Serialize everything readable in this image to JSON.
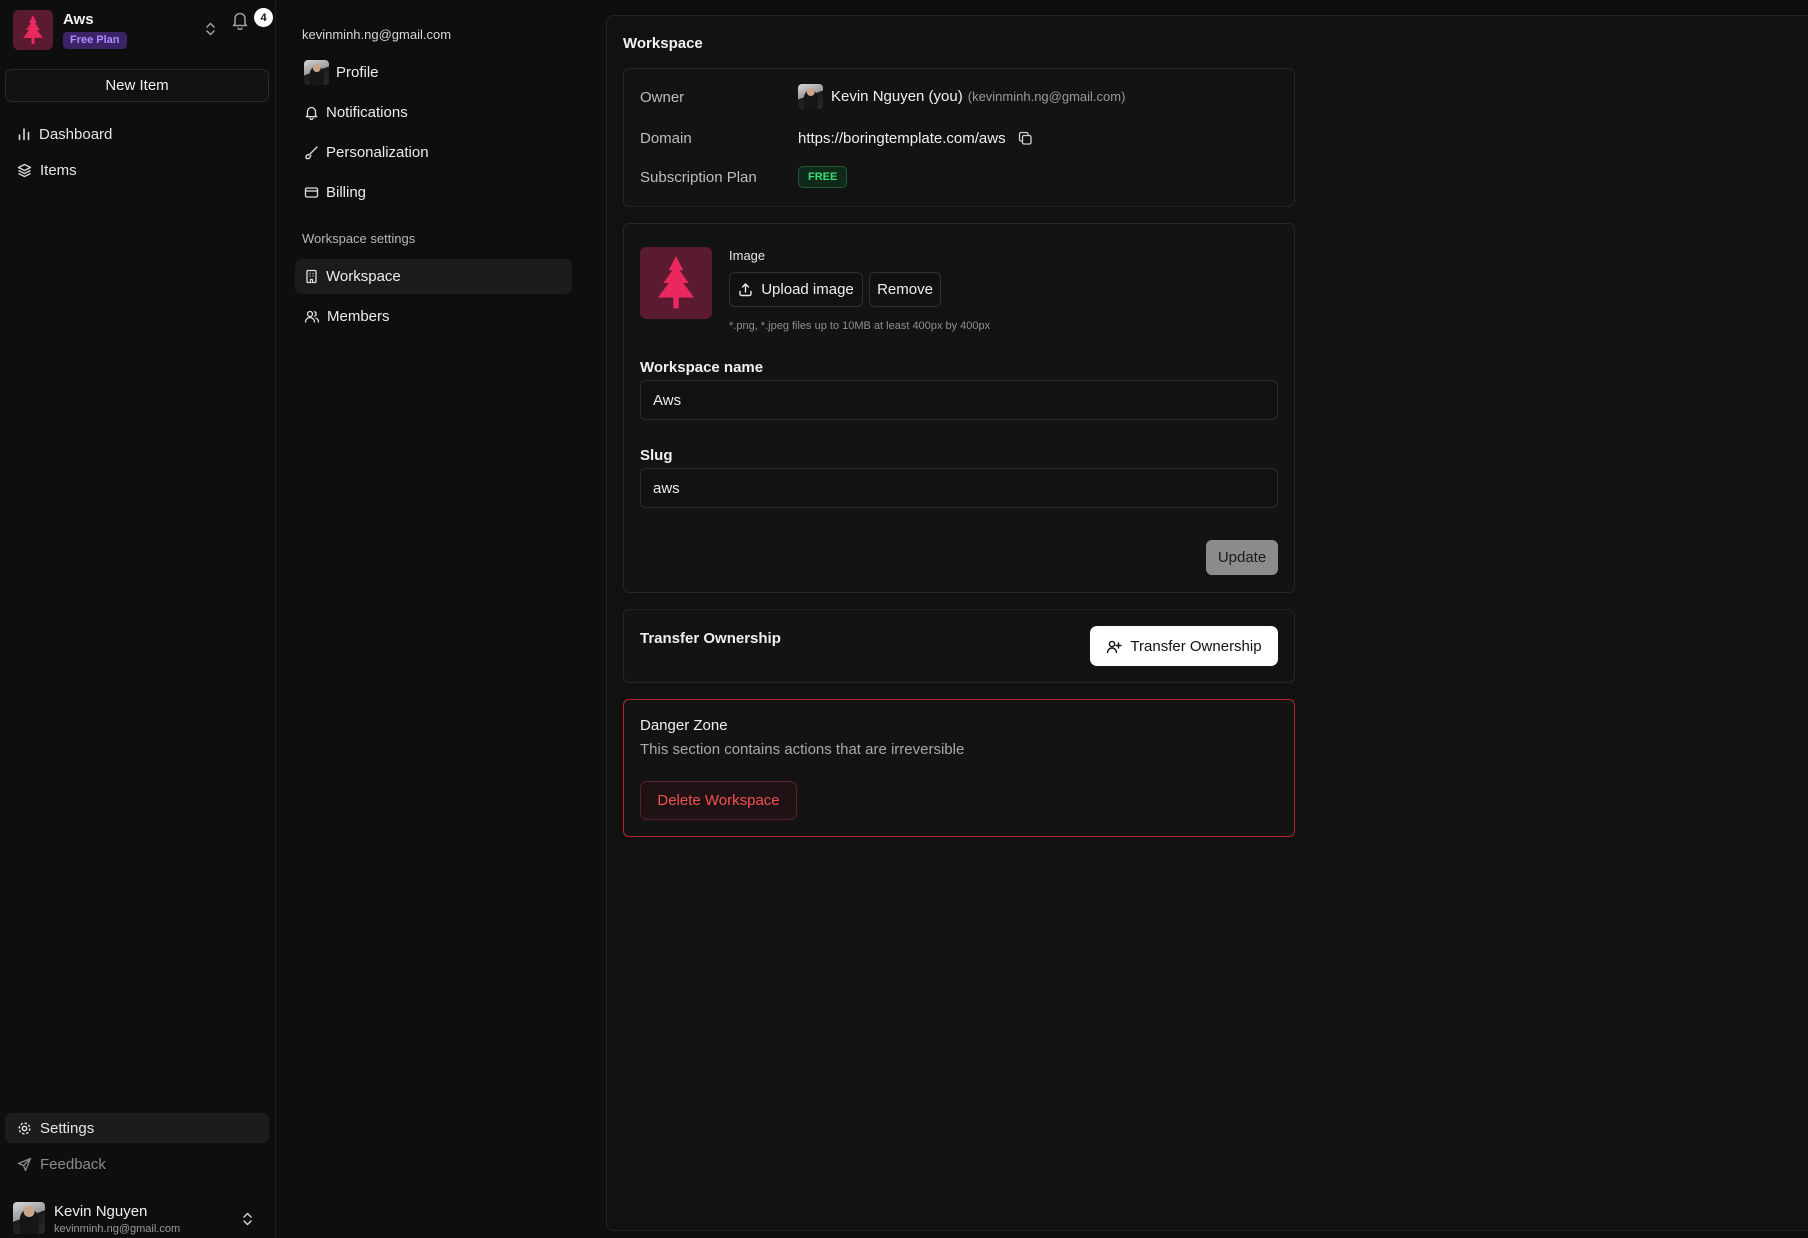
{
  "workspace_switcher": {
    "name": "Aws",
    "plan": "Free Plan",
    "notifications_count": "4"
  },
  "sidebar": {
    "new_item_label": "New Item",
    "items": [
      {
        "label": "Dashboard",
        "icon": "bar-chart-icon"
      },
      {
        "label": "Items",
        "icon": "layers-icon"
      }
    ],
    "bottom_items": [
      {
        "label": "Settings",
        "icon": "gear-icon"
      },
      {
        "label": "Feedback",
        "icon": "send-icon"
      }
    ],
    "user": {
      "name": "Kevin Nguyen",
      "email": "kevinminh.ng@gmail.com"
    }
  },
  "settings_nav": {
    "account_email": "kevinminh.ng@gmail.com",
    "account_items": [
      {
        "label": "Profile",
        "icon": "avatar"
      },
      {
        "label": "Notifications",
        "icon": "bell-icon"
      },
      {
        "label": "Personalization",
        "icon": "brush-icon"
      },
      {
        "label": "Billing",
        "icon": "credit-card-icon"
      }
    ],
    "workspace_section_label": "Workspace settings",
    "workspace_items": [
      {
        "label": "Workspace",
        "icon": "building-icon",
        "active": true
      },
      {
        "label": "Members",
        "icon": "users-icon"
      }
    ]
  },
  "main": {
    "title": "Workspace",
    "info": {
      "owner_label": "Owner",
      "owner_name": "Kevin Nguyen (you)",
      "owner_email": "(kevinminh.ng@gmail.com)",
      "domain_label": "Domain",
      "domain_value": "https://boringtemplate.com/aws",
      "plan_label": "Subscription Plan",
      "plan_value": "FREE"
    },
    "form": {
      "image_label": "Image",
      "upload_label": "Upload image",
      "remove_label": "Remove",
      "image_hint": "*.png, *.jpeg files up to 10MB at least 400px by 400px",
      "name_label": "Workspace name",
      "name_value": "Aws",
      "slug_label": "Slug",
      "slug_value": "aws",
      "update_label": "Update"
    },
    "transfer": {
      "title": "Transfer Ownership",
      "button_label": "Transfer Ownership"
    },
    "danger": {
      "title": "Danger Zone",
      "description": "This section contains actions that are irreversible",
      "delete_label": "Delete Workspace"
    }
  },
  "colors": {
    "background": "#0e0e0f",
    "accent_pink": "#e8285e",
    "plan_badge": "#b08cff",
    "free_badge": "#3ddc7a",
    "danger": "#f05252"
  }
}
